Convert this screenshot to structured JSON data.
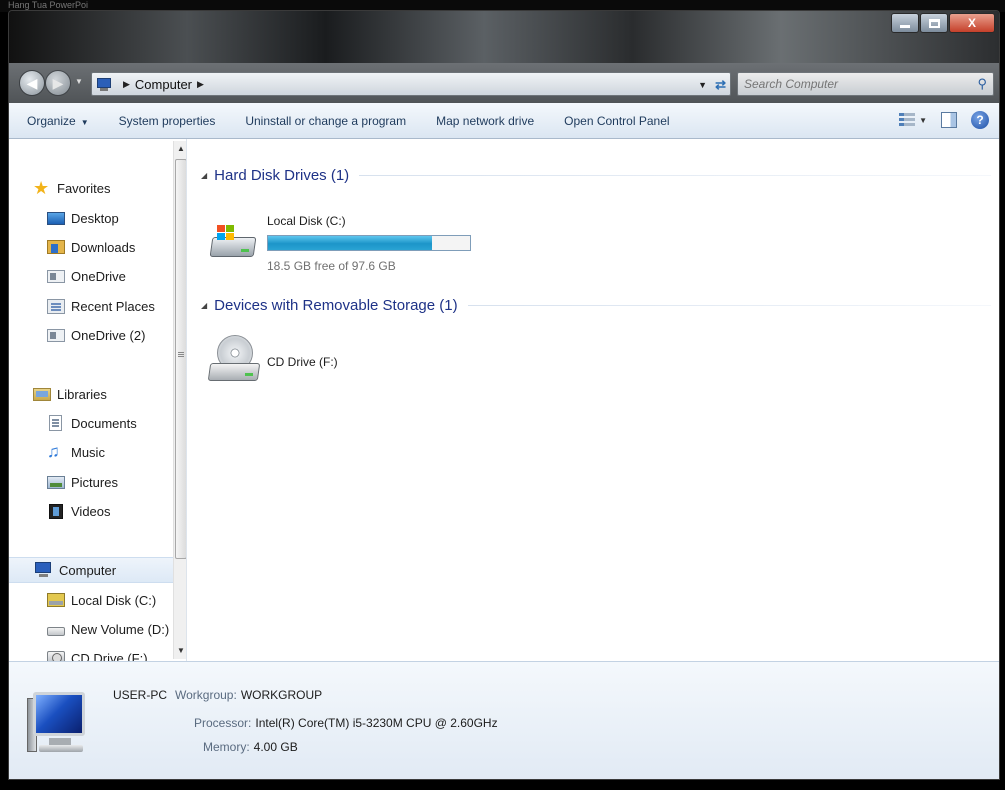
{
  "background_strip_text": "Hang Tua   PowerPoi",
  "window_controls": {
    "minimize": "minimize",
    "maximize": "maximize",
    "close": "X"
  },
  "address": {
    "breadcrumb": [
      "Computer"
    ],
    "search_placeholder": "Search Computer"
  },
  "toolbar": {
    "organize": "Organize",
    "system_properties": "System properties",
    "uninstall": "Uninstall or change a program",
    "map_drive": "Map network drive",
    "control_panel": "Open Control Panel"
  },
  "nav": {
    "favorites": "Favorites",
    "desktop": "Desktop",
    "downloads": "Downloads",
    "onedrive": "OneDrive",
    "recent": "Recent Places",
    "onedrive2": "OneDrive (2)",
    "libraries": "Libraries",
    "documents": "Documents",
    "music": "Music",
    "pictures": "Pictures",
    "videos": "Videos",
    "computer": "Computer",
    "localdisk": "Local Disk (C:)",
    "newvolume": "New Volume (D:)",
    "cddrive": "CD Drive (F:)"
  },
  "groups": {
    "hdd_title": "Hard Disk Drives (1)",
    "removable_title": "Devices with Removable Storage (1)"
  },
  "drives": {
    "c_label": "Local Disk (C:)",
    "c_free_text": "18.5 GB free of 97.6 GB",
    "c_used_fraction": 0.81,
    "f_label": "CD Drive (F:)"
  },
  "details": {
    "pc_name": "USER-PC",
    "workgroup_label": "Workgroup:",
    "workgroup_value": "WORKGROUP",
    "processor_label": "Processor:",
    "processor_value": "Intel(R) Core(TM) i5-3230M CPU @ 2.60GHz",
    "memory_label": "Memory:",
    "memory_value": "4.00 GB"
  },
  "colors": {
    "capacity_fill": "#1c95c9",
    "group_title": "#1e3287",
    "command_text": "#1e3a5c"
  }
}
